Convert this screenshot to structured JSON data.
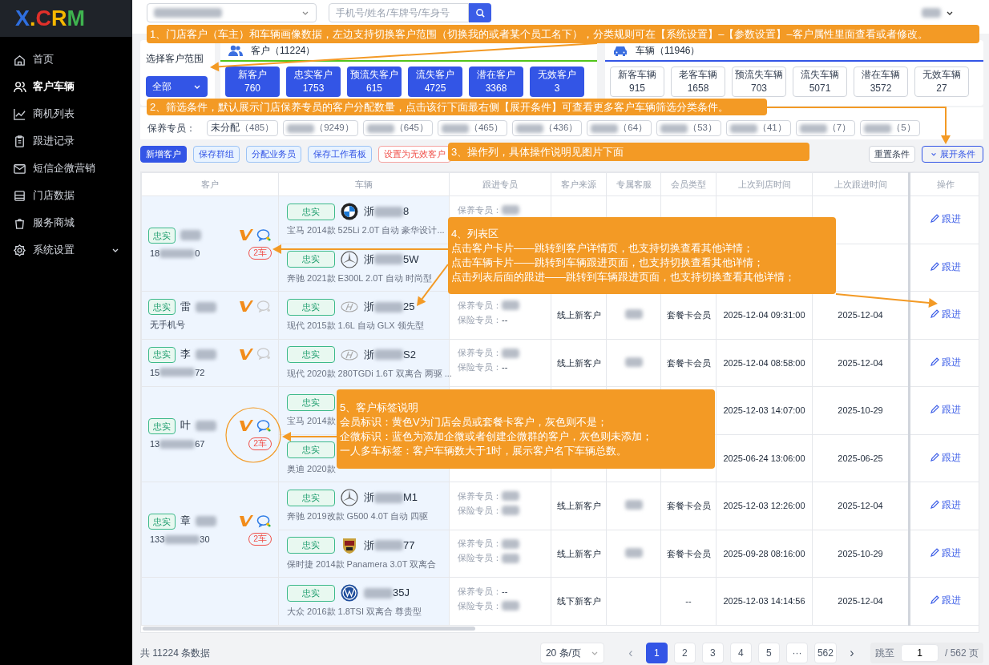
{
  "sidebar": {
    "logo": [
      {
        "text": "X",
        "color": "#2f6fe0"
      },
      {
        "text": ".",
        "color": "#f5b800"
      },
      {
        "text": "C",
        "color": "#e0302a"
      },
      {
        "text": "R",
        "color": "#f5b800"
      },
      {
        "text": "M",
        "color": "#3fb34f"
      }
    ],
    "items": [
      {
        "label": "首页",
        "selected": false
      },
      {
        "label": "客户车辆",
        "selected": true
      },
      {
        "label": "商机列表",
        "selected": false
      },
      {
        "label": "跟进记录",
        "selected": false
      },
      {
        "label": "短信企微营销",
        "selected": false
      },
      {
        "label": "门店数据",
        "selected": false
      },
      {
        "label": "服务商城",
        "selected": false
      },
      {
        "label": "系统设置",
        "selected": false,
        "expanded": false
      }
    ]
  },
  "topbar": {
    "store_select": {
      "redacted": true
    },
    "search": {
      "placeholder": "手机号/姓名/车牌号/车身号"
    },
    "user": {
      "redacted": true
    }
  },
  "scope": {
    "label": "选择客户范围",
    "value": "全部"
  },
  "customer_stats": {
    "title": "客户（11224）",
    "items": [
      {
        "label": "新客户",
        "count": "760"
      },
      {
        "label": "忠实客户",
        "count": "1753"
      },
      {
        "label": "预流失客户",
        "count": "615"
      },
      {
        "label": "流失客户",
        "count": "4725"
      },
      {
        "label": "潜在客户",
        "count": "3368"
      },
      {
        "label": "无效客户",
        "count": "3"
      }
    ]
  },
  "vehicle_stats": {
    "title": "车辆（11946）",
    "items": [
      {
        "label": "新客车辆",
        "count": "915"
      },
      {
        "label": "老客车辆",
        "count": "1658"
      },
      {
        "label": "预流失车辆",
        "count": "703"
      },
      {
        "label": "流失车辆",
        "count": "5071"
      },
      {
        "label": "潜在车辆",
        "count": "3572"
      },
      {
        "label": "无效车辆",
        "count": "27"
      }
    ]
  },
  "filter": {
    "label": "保养专员：",
    "chips": [
      {
        "name": "未分配",
        "count": "（485）"
      },
      {
        "count": "（9249）"
      },
      {
        "count": "（645）"
      },
      {
        "count": "（465）"
      },
      {
        "count": "（436）"
      },
      {
        "count": "（64）"
      },
      {
        "count": "（53）"
      },
      {
        "count": "（41）"
      },
      {
        "count": "（7）"
      },
      {
        "count": "（5）"
      }
    ]
  },
  "actions": [
    {
      "label": "新增客户",
      "kind": "primary"
    },
    {
      "label": "保存群组",
      "kind": "plain"
    },
    {
      "label": "分配业务员",
      "kind": "plain"
    },
    {
      "label": "保存工作看板",
      "kind": "plain"
    },
    {
      "label": "设置为无效客户",
      "kind": "danger"
    }
  ],
  "right_actions": [
    {
      "label": "重置条件",
      "kind": "reset"
    },
    {
      "label": "展开条件",
      "kind": "expand"
    }
  ],
  "table": {
    "columns": [
      "客户",
      "车辆",
      "跟进专员",
      "客户来源",
      "专属客服",
      "会员类型",
      "上次到店时间",
      "上次跟进时间",
      "操作"
    ],
    "customers": [
      {
        "tag": "忠实",
        "name_redacted": true,
        "phone_start": "18",
        "phone_end": "0",
        "member": true,
        "wecom": true,
        "cars": "2车",
        "vehicles": [
          {
            "vehicle": {
              "tag": "忠实",
              "brand_logo": {
                "kind": "quartered-roundel"
              },
              "plate_start": "浙",
              "plate_end": "8",
              "model": "宝马 2014款 525Li 2.0T 自动 豪华设计..."
            },
            "maint": {
              "label": "保养专员：",
              "redacted": true
            },
            "action": "跟进"
          },
          {
            "vehicle": {
              "tag": "忠实",
              "brand_logo": {
                "kind": "three-point-star"
              },
              "plate_start": "浙",
              "plate_end": "5W",
              "model": "奔驰 2021款 E300L 2.0T 自动 时尚型"
            },
            "action": "跟进"
          }
        ]
      },
      {
        "tag": "忠实",
        "name": "雷",
        "name_redacted": true,
        "phone_note": "无手机号",
        "member": true,
        "wecom": false,
        "vehicles": [
          {
            "vehicle": {
              "tag": "忠实",
              "brand_logo": {
                "kind": "slanted-oval"
              },
              "plate_start": "浙",
              "plate_end": "25",
              "model": "现代 2015款 1.6L 自动 GLX 领先型"
            },
            "maint": {
              "label": "保养专员：",
              "redacted": true
            },
            "ins": {
              "label": "保险专员：",
              "value": "--"
            },
            "source": "线上新客户",
            "service_redacted": true,
            "member_type": "套餐卡会员",
            "last_visit": "2025-12-04 09:31:00",
            "last_follow": "2025-12-04",
            "action": "跟进"
          }
        ]
      },
      {
        "tag": "忠实",
        "name": "李",
        "name_redacted": true,
        "phone_start": "15",
        "phone_end": "72",
        "member": true,
        "wecom": false,
        "vehicles": [
          {
            "vehicle": {
              "tag": "忠实",
              "brand_logo": {
                "kind": "slanted-oval"
              },
              "plate_start": "浙",
              "plate_end": "S2",
              "model": "现代 2020款 280TGDi 1.6T 双离合 两驱 ..."
            },
            "maint": {
              "label": "保养专员：",
              "redacted": true
            },
            "ins": {
              "label": "保险专员：",
              "value": "--"
            },
            "source": "线上新客户",
            "service_redacted": true,
            "member_type": "套餐卡会员",
            "last_visit": "2025-12-04 08:58:00",
            "last_follow": "2025-12-04",
            "action": "跟进"
          }
        ]
      },
      {
        "tag": "忠实",
        "name": "叶",
        "name_redacted": true,
        "phone_start": "13",
        "phone_end": "67",
        "member": true,
        "wecom": true,
        "cars": "2车",
        "vehicles": [
          {
            "vehicle": {
              "tag": "忠实",
              "model": "宝马 2014款"
            },
            "last_visit": "2025-12-03 14:07:00",
            "last_follow": "2025-10-29",
            "action": "跟进"
          },
          {
            "vehicle": {
              "tag": "忠实",
              "model": "奥迪 2020款"
            },
            "last_visit": "2025-06-24 13:06:00",
            "last_follow": "2025-06-25",
            "action": "跟进"
          }
        ]
      },
      {
        "tag": "忠实",
        "name": "章",
        "name_redacted": true,
        "phone_start": "133",
        "phone_end": "30",
        "member": true,
        "wecom": true,
        "cars": "2车",
        "vehicles": [
          {
            "vehicle": {
              "tag": "忠实",
              "brand_logo": {
                "kind": "three-point-star"
              },
              "plate_start": "浙",
              "plate_end": "M1",
              "model": "奔驰 2019改款 G500 4.0T 自动 四驱"
            },
            "maint": {
              "label": "保养专员：",
              "redacted": true
            },
            "ins": {
              "label": "保险专员：",
              "redacted": true
            },
            "source": "线上新客户",
            "service_redacted": true,
            "member_type": "套餐卡会员",
            "last_visit": "2025-12-03 12:26:00",
            "last_follow": "2025-12-04",
            "action": "跟进"
          },
          {
            "vehicle": {
              "tag": "忠实",
              "brand_logo": {
                "kind": "crest"
              },
              "plate_start": "浙",
              "plate_end": "77",
              "model": "保时捷 2014款 Panamera 3.0T 双离合"
            },
            "maint": {
              "label": "保养专员：",
              "redacted": true
            },
            "ins": {
              "label": "保险专员：",
              "redacted": true
            },
            "source": "线上新客户",
            "service_redacted": true,
            "member_type": "套餐卡会员",
            "last_visit": "2025-09-28 08:16:00",
            "last_follow": "2025-10-29",
            "action": "跟进"
          }
        ]
      },
      {
        "vehicles": [
          {
            "vehicle": {
              "tag": "忠实",
              "brand_logo": {
                "kind": "circle-emblem"
              },
              "plate_end": "35J",
              "model": "大众 2016款 1.8TSI 双离合 尊贵型"
            },
            "maint": {
              "label": "保养专员：",
              "value": "--"
            },
            "ins": {
              "label": "保险专员：",
              "redacted": true
            },
            "source": "线下新客户",
            "member_type": "--",
            "last_visit": "2025-12-03 14:14:56",
            "last_follow": "2025-12-04",
            "action": "跟进"
          }
        ]
      }
    ]
  },
  "pagination": {
    "total": "共 11224 条数据",
    "page_size": "20 条/页",
    "prev": "‹",
    "pages": [
      {
        "label": "1",
        "selected": true
      },
      {
        "label": "2",
        "selected": false
      },
      {
        "label": "3",
        "selected": false
      },
      {
        "label": "4",
        "selected": false
      },
      {
        "label": "5",
        "selected": false
      },
      {
        "label": "···",
        "selected": false
      },
      {
        "label": "562",
        "selected": false
      }
    ],
    "next": "›",
    "jump_label": "跳至",
    "jump_value": "1",
    "page_total": "/ 562 页"
  },
  "annotations": [
    {
      "lines": [
        "1、门店客户（车主）和车辆画像数据，左边支持切换客户范围（切换我的或者某个员工名下），分类规则可在【系统设置】–【参数设置】–客户属性里面查看或者修改。"
      ]
    },
    {
      "lines": [
        "2、筛选条件，默认展示门店保养专员的客户分配数量，点击该行下面最右侧【展开条件】可查看更多客户车辆筛选分类条件。"
      ]
    },
    {
      "lines": [
        "3、操作列，具体操作说明见图片下面"
      ]
    },
    {
      "lines": [
        "4、列表区",
        "点击客户卡片——跳转到客户详情页，也支持切换查看其他详情；",
        "点击车辆卡片——跳转到车辆跟进页面，也支持切换查看其他详情；",
        "点击列表后面的跟进——跳转到车辆跟进页面，也支持切换查看其他详情；"
      ]
    },
    {
      "lines": [
        "5、客户标签说明",
        "会员标识：黄色V为门店会员或套餐卡客户，灰色则不是；",
        "企微标识：蓝色为添加企微或者创建企微群的客户，灰色则未添加；",
        "一人多车标签：客户车辆数大于1时，展示客户名下车辆总数。"
      ]
    }
  ]
}
